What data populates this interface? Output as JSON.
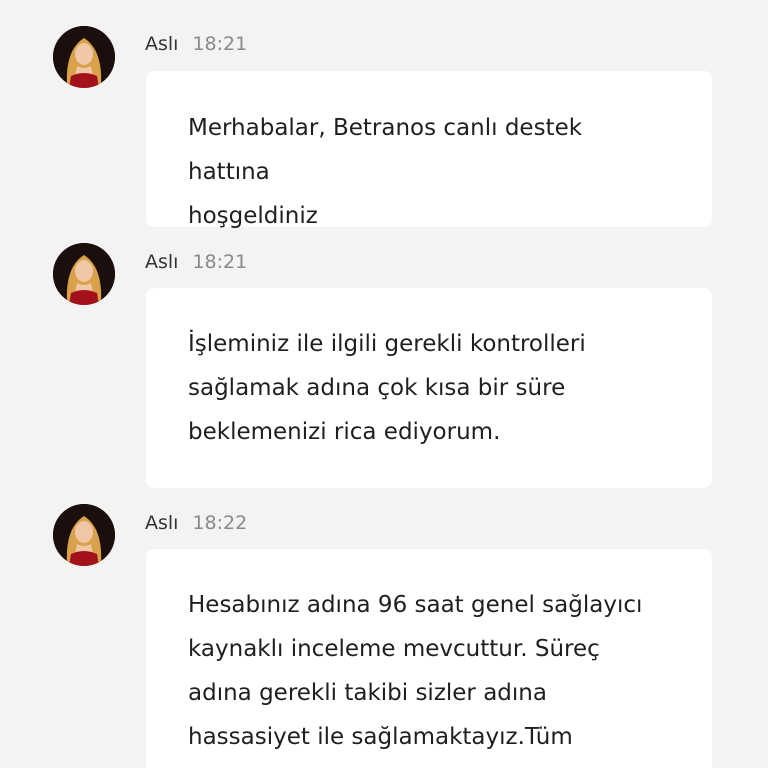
{
  "messages": [
    {
      "sender": "Aslı",
      "time": "18:21",
      "text": "Merhabalar, Betranos canlı destek hattına\nhoşgeldiniz"
    },
    {
      "sender": "Aslı",
      "time": "18:21",
      "text": "İşleminiz ile ilgili gerekli kontrolleri\nsağlamak adına çok kısa bir süre\nbeklemenizi rica ediyorum."
    },
    {
      "sender": "Aslı",
      "time": "18:22",
      "text": "Hesabınız adına 96 saat genel sağlayıcı\nkaynaklı inceleme mevcuttur. Süreç\nadına gerekli takibi sizler adına\nhassasiyet ile sağlamaktayız.Tüm"
    }
  ],
  "avatar_icon": "agent-avatar-icon",
  "colors": {
    "background": "#f3f3f3",
    "bubble": "#ffffff",
    "text": "#1f1f1f",
    "time": "#8a8a8a"
  }
}
